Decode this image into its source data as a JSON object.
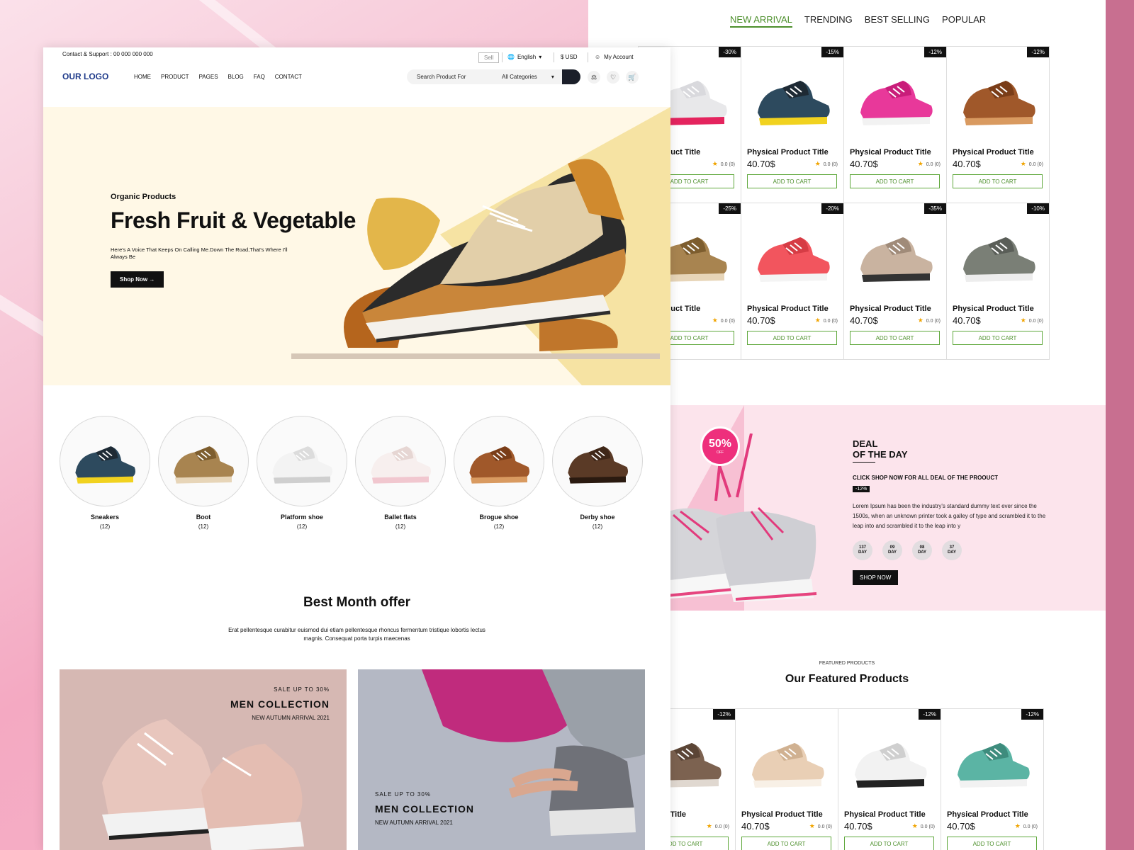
{
  "right": {
    "tabs": [
      "NEW ARRIVAL",
      "TRENDING",
      "BEST SELLING",
      "POPULAR"
    ],
    "products": [
      {
        "name": "al Product Title",
        "price": "$",
        "badge": "-30%",
        "rating": "0.0 (0)",
        "cart": "ADD TO CART",
        "img": "running-shoe"
      },
      {
        "name": "Physical Product Title",
        "price": "40.70$",
        "badge": "-15%",
        "rating": "0.0 (0)",
        "cart": "ADD TO CART",
        "img": "sneaker-navy"
      },
      {
        "name": "Physical Product Title",
        "price": "40.70$",
        "badge": "-12%",
        "rating": "0.0 (0)",
        "cart": "ADD TO CART",
        "img": "pink-shoe"
      },
      {
        "name": "Physical Product Title",
        "price": "40.70$",
        "badge": "-12%",
        "rating": "0.0 (0)",
        "cart": "ADD TO CART",
        "img": "brogue"
      },
      {
        "name": "al Product Title",
        "price": "$",
        "badge": "-25%",
        "rating": "0.0 (0)",
        "cart": "ADD TO CART",
        "img": "work-boot"
      },
      {
        "name": "Physical Product Title",
        "price": "40.70$",
        "badge": "-20%",
        "rating": "0.0 (0)",
        "cart": "ADD TO CART",
        "img": "red-shoe"
      },
      {
        "name": "Physical Product Title",
        "price": "40.70$",
        "badge": "-35%",
        "rating": "0.0 (0)",
        "cart": "ADD TO CART",
        "img": "chain-boot"
      },
      {
        "name": "Physical Product Title",
        "price": "40.70$",
        "badge": "-10%",
        "rating": "0.0 (0)",
        "cart": "ADD TO CART",
        "img": "grey-sneaker"
      }
    ],
    "deal": {
      "title1": "DEAL",
      "title2": "OF THE DAY",
      "sub": "CLICK SHOP NOW FOR ALL DEAL OF THE PROOUCT",
      "badge": "-12%",
      "text": "Lorem Ipsum has been the industry's standard dummy text ever since the 1500s, when an unknown printer took a galley of type and scrambled it to the leap into and scrambled it to  the leap into y",
      "percent": "50%",
      "off": "OFF",
      "timers": [
        {
          "v": "137",
          "u": "DAY"
        },
        {
          "v": "09",
          "u": "DAY"
        },
        {
          "v": "08",
          "u": "DAY"
        },
        {
          "v": "37",
          "u": "DAY"
        }
      ],
      "btn": "SHOP NOW"
    },
    "featured": {
      "small": "FEATURED PRODUCTS",
      "title": "Our Featured Products",
      "products": [
        {
          "name": "Product Title",
          "price": "",
          "badge": "-12%",
          "rating": "0.0 (0)",
          "cart": "ADD TO CART",
          "img": "brown-shoe"
        },
        {
          "name": "Physical Product Title",
          "price": "40.70$",
          "badge": "",
          "rating": "0.0 (0)",
          "cart": "ADD TO CART",
          "img": "beige-boot"
        },
        {
          "name": "Physical Product Title",
          "price": "40.70$",
          "badge": "-12%",
          "rating": "0.0 (0)",
          "cart": "ADD TO CART",
          "img": "white-boot"
        },
        {
          "name": "Physical Product Title",
          "price": "40.70$",
          "badge": "-12%",
          "rating": "0.0 (0)",
          "cart": "ADD TO CART",
          "img": "teal-sneaker"
        }
      ]
    }
  },
  "left": {
    "contact": "Contact & Support : 00 000 000 000",
    "sell": "Sell",
    "lang": "English",
    "currency": "USD",
    "account": "My Account",
    "logo": "OUR LOGO",
    "nav": [
      "HOME",
      "PRODUCT",
      "PAGES",
      "BLOG",
      "FAQ",
      "CONTACT"
    ],
    "search_placeholder": "Search Product For",
    "categories": "All Categories",
    "hero": {
      "sub": "Organic Products",
      "title": "Fresh Fruit & Vegetable",
      "text": "Here's A Voice That Keeps On Calling Me.Down The Road,That's Where I'll Always Be",
      "btn": "Shop Now"
    },
    "cats": [
      {
        "name": "Sneakers",
        "count": "(12)",
        "img": "sneaker-navy"
      },
      {
        "name": "Boot",
        "count": "(12)",
        "img": "work-boot"
      },
      {
        "name": "Platform shoe",
        "count": "(12)",
        "img": "heel"
      },
      {
        "name": "Ballet flats",
        "count": "(12)",
        "img": "ballet"
      },
      {
        "name": "Brogue shoe",
        "count": "(12)",
        "img": "brogue"
      },
      {
        "name": "Derby shoe",
        "count": "(12)",
        "img": "derby"
      }
    ],
    "best": {
      "title": "Best Month offer",
      "text": "Erat pellentesque curabitur euismod dui etiam pellentesque rhoncus fermentum tristique lobortis lectus magnis. Consequat porta turpis maecenas"
    },
    "promos": [
      {
        "s": "SALE UP TO 30%",
        "t": "MEN COLLECTION",
        "n": "NEW AUTUMN ARRIVAL 2021"
      },
      {
        "s": "SALE UP TO 30%",
        "t": "MEN COLLECTION",
        "n": "NEW AUTUMN ARRIVAL 2021"
      }
    ]
  }
}
